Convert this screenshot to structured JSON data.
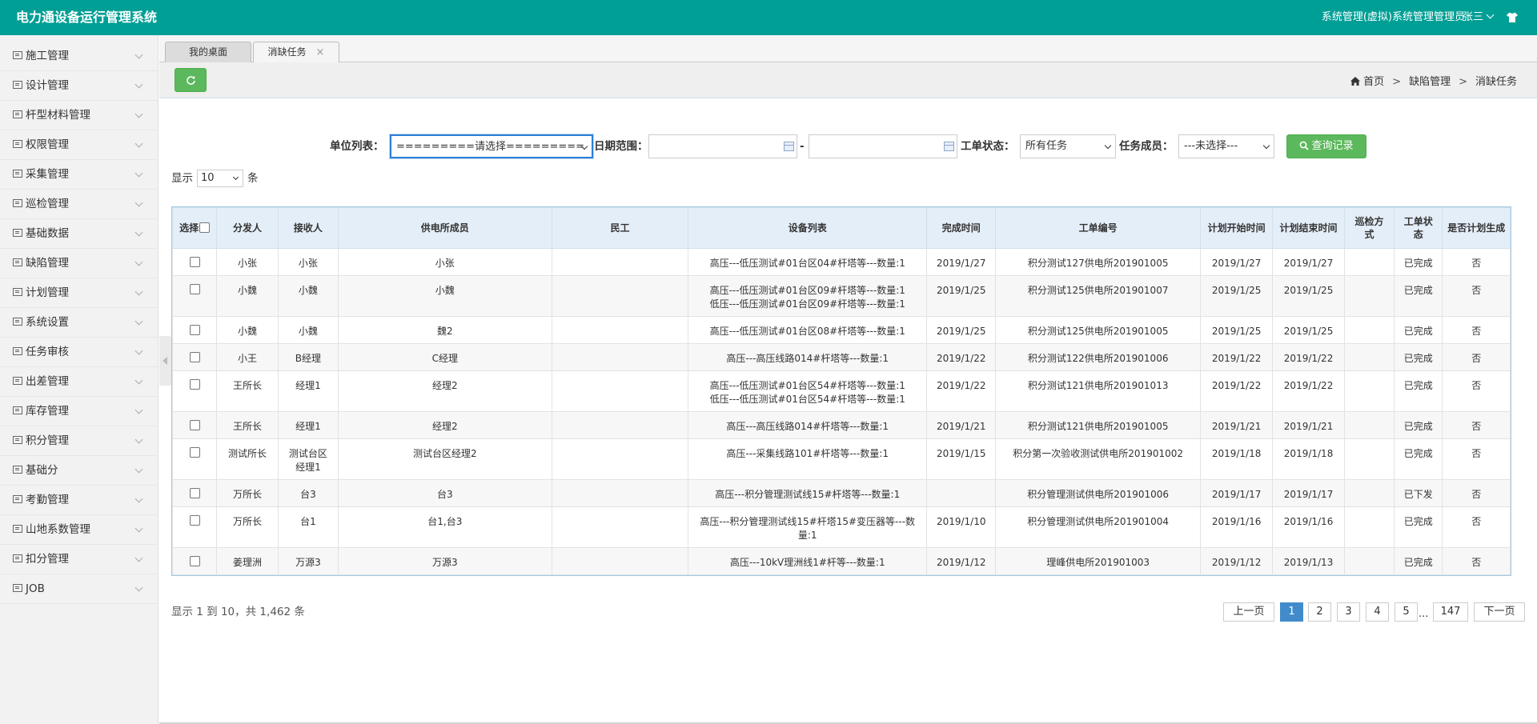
{
  "app": {
    "title": "电力通设备运行管理系统",
    "user_role": "系统管理(虚拟)系统管理管理员",
    "user_name": "张三"
  },
  "sidebar": {
    "items": [
      {
        "label": "施工管理"
      },
      {
        "label": "设计管理"
      },
      {
        "label": "杆型材料管理"
      },
      {
        "label": "权限管理"
      },
      {
        "label": "采集管理"
      },
      {
        "label": "巡检管理"
      },
      {
        "label": "基础数据"
      },
      {
        "label": "缺陷管理"
      },
      {
        "label": "计划管理"
      },
      {
        "label": "系统设置"
      },
      {
        "label": "任务审核"
      },
      {
        "label": "出差管理"
      },
      {
        "label": "库存管理"
      },
      {
        "label": "积分管理"
      },
      {
        "label": "基础分"
      },
      {
        "label": "考勤管理"
      },
      {
        "label": "山地系数管理"
      },
      {
        "label": "扣分管理"
      },
      {
        "label": "JOB"
      }
    ]
  },
  "tabs": [
    {
      "label": "我的桌面"
    },
    {
      "label": "消缺任务",
      "close": "×"
    }
  ],
  "breadcrumb": {
    "home": "首页",
    "sep": ">",
    "level1": "缺陷管理",
    "level2": "消缺任务"
  },
  "filters": {
    "unit_label": "单位列表：",
    "unit_value": "=========请选择=========",
    "date_label": "日期范围：",
    "date_sep": "-",
    "status_label": "工单状态：",
    "status_value": "所有任务",
    "member_label": "任务成员：",
    "member_value": "---未选择---",
    "query_button": "查询记录"
  },
  "page_size": {
    "prefix": "显示",
    "value": "10",
    "suffix": "条"
  },
  "table": {
    "headers": [
      "选择",
      "分发人",
      "接收人",
      "供电所成员",
      "民工",
      "设备列表",
      "完成时间",
      "工单编号",
      "计划开始时间",
      "计划结束时间",
      "巡检方式",
      "工单状态",
      "是否计划生成"
    ],
    "rows": [
      {
        "c1": "小张",
        "c2": "小张",
        "c3": "小张",
        "c4": "",
        "c5": "高压---低压测试#01台区04#杆塔等---数量:1",
        "c6": "2019/1/27",
        "c7": "积分测试127供电所201901005",
        "c8": "2019/1/27",
        "c9": "2019/1/27",
        "c10": "",
        "c11": "已完成",
        "c12": "否"
      },
      {
        "c1": "小魏",
        "c2": "小魏",
        "c3": "小魏",
        "c4": "",
        "c5": "高压---低压测试#01台区09#杆塔等---数量:1",
        "c5b": "低压---低压测试#01台区09#杆塔等---数量:1",
        "c6": "2019/1/25",
        "c7": "积分测试125供电所201901007",
        "c8": "2019/1/25",
        "c9": "2019/1/25",
        "c10": "",
        "c11": "已完成",
        "c12": "否"
      },
      {
        "c1": "小魏",
        "c2": "小魏",
        "c3": "魏2",
        "c4": "",
        "c5": "高压---低压测试#01台区08#杆塔等---数量:1",
        "c6": "2019/1/25",
        "c7": "积分测试125供电所201901005",
        "c8": "2019/1/25",
        "c9": "2019/1/25",
        "c10": "",
        "c11": "已完成",
        "c12": "否"
      },
      {
        "c1": "小王",
        "c2": "B经理",
        "c3": "C经理",
        "c4": "",
        "c5": "高压---高压线路014#杆塔等---数量:1",
        "c6": "2019/1/22",
        "c7": "积分测试122供电所201901006",
        "c8": "2019/1/22",
        "c9": "2019/1/22",
        "c10": "",
        "c11": "已完成",
        "c12": "否"
      },
      {
        "c1": "王所长",
        "c2": "经理1",
        "c3": "经理2",
        "c4": "",
        "c5": "高压---低压测试#01台区54#杆塔等---数量:1",
        "c5b": "低压---低压测试#01台区54#杆塔等---数量:1",
        "c6": "2019/1/22",
        "c7": "积分测试121供电所201901013",
        "c8": "2019/1/22",
        "c9": "2019/1/22",
        "c10": "",
        "c11": "已完成",
        "c12": "否"
      },
      {
        "c1": "王所长",
        "c2": "经理1",
        "c3": "经理2",
        "c4": "",
        "c5": "高压---高压线路014#杆塔等---数量:1",
        "c6": "2019/1/21",
        "c7": "积分测试121供电所201901005",
        "c8": "2019/1/21",
        "c9": "2019/1/21",
        "c10": "",
        "c11": "已完成",
        "c12": "否"
      },
      {
        "c1": "测试所长",
        "c2": "测试台区",
        "c2b": "经理1",
        "c3": "测试台区经理2",
        "c4": "",
        "c5": "高压---采集线路101#杆塔等---数量:1",
        "c6": "2019/1/15",
        "c7": "积分第一次验收测试供电所201901002",
        "c8": "2019/1/18",
        "c9": "2019/1/18",
        "c10": "",
        "c11": "已完成",
        "c12": "否"
      },
      {
        "c1": "万所长",
        "c2": "台3",
        "c3": "台3",
        "c4": "",
        "c5": "高压---积分管理测试线15#杆塔等---数量:1",
        "c6": "",
        "c7": "积分管理测试供电所201901006",
        "c8": "2019/1/17",
        "c9": "2019/1/17",
        "c10": "",
        "c11": "已下发",
        "c12": "否"
      },
      {
        "c1": "万所长",
        "c2": "台1",
        "c3": "台1,台3",
        "c4": "",
        "c5": "高压---积分管理测试线15#杆塔15#变压器等---数",
        "c5b": "量:1",
        "c6": "2019/1/10",
        "c7": "积分管理测试供电所201901004",
        "c8": "2019/1/16",
        "c9": "2019/1/16",
        "c10": "",
        "c11": "已完成",
        "c12": "否"
      },
      {
        "c1": "姜理洲",
        "c2": "万源3",
        "c3": "万源3",
        "c4": "",
        "c5": "高压---10kV理洲线1#杆等---数量:1",
        "c6": "2019/1/12",
        "c7": "理峰供电所201901003",
        "c8": "2019/1/12",
        "c9": "2019/1/13",
        "c10": "",
        "c11": "已完成",
        "c12": "否"
      }
    ]
  },
  "footer": {
    "info": "显示 1 到 10，共 1,462 条",
    "prev": "上一页",
    "next": "下一页",
    "pages": [
      "1",
      "2",
      "3",
      "4",
      "5",
      "147"
    ],
    "ellipsis": "..."
  },
  "colors": {
    "header": "#009f95",
    "button_green": "#5cb85c",
    "pager_active": "#428bca"
  }
}
